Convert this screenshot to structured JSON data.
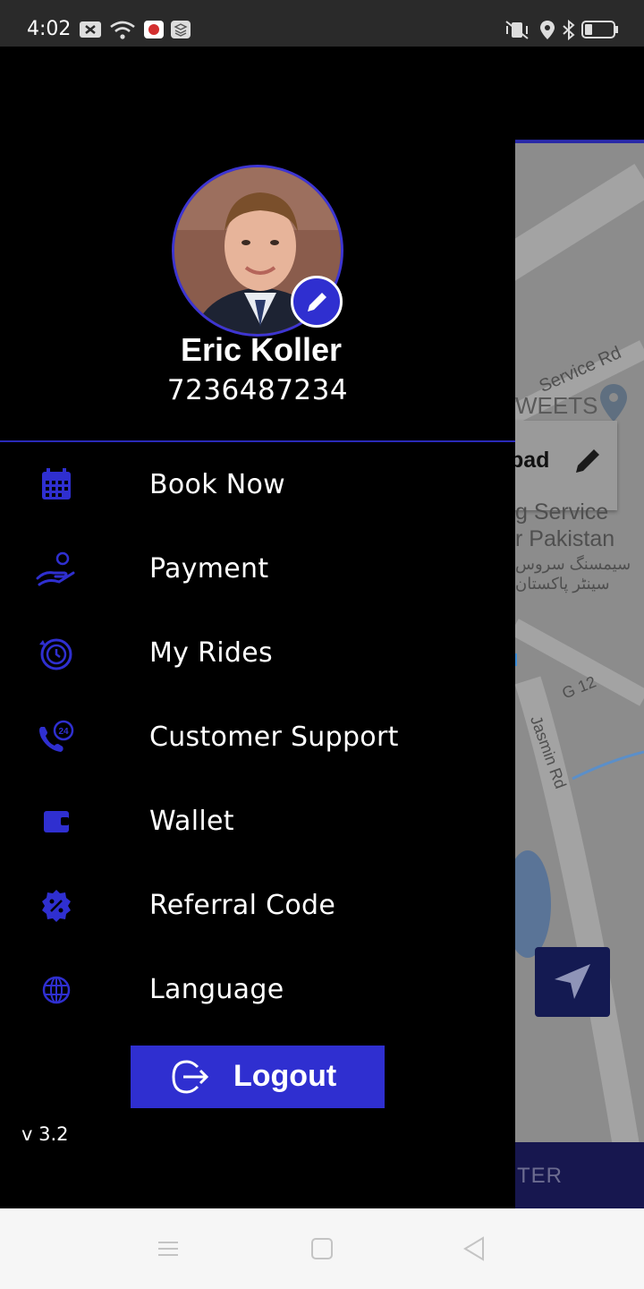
{
  "status_bar": {
    "time": "4:02",
    "icons": [
      "notification-x-icon",
      "wifi-icon",
      "app-notification-icon",
      "stack-icon",
      "vibrate-icon",
      "location-icon",
      "bluetooth-icon",
      "battery-icon"
    ]
  },
  "map": {
    "labels": {
      "service_rd": "Service Rd",
      "sweets": "WEETS",
      "card_text": "bad",
      "service": "g Service",
      "pakistan": "r Pakistan",
      "urdu1": "سیمسنگ سروس",
      "urdu2": "سینٹر پاکستان",
      "g12": "G 12",
      "jasmin": "Jasmin Rd"
    },
    "bottom_button": "TER"
  },
  "profile": {
    "name": "Eric Koller",
    "phone": "7236487234"
  },
  "menu": [
    {
      "label": "Book Now",
      "icon": "calendar-icon"
    },
    {
      "label": "Payment",
      "icon": "payment-hand-icon"
    },
    {
      "label": "My Rides",
      "icon": "history-icon"
    },
    {
      "label": "Customer Support",
      "icon": "support-24-icon"
    },
    {
      "label": "Wallet",
      "icon": "wallet-icon"
    },
    {
      "label": "Referral Code",
      "icon": "discount-badge-icon"
    },
    {
      "label": "Language",
      "icon": "globe-icon"
    }
  ],
  "logout": {
    "label": "Logout",
    "icon": "logout-icon"
  },
  "version": "v 3.2",
  "nav_bar": [
    "menu-icon",
    "home-icon",
    "back-icon"
  ],
  "colors": {
    "accent": "#2f2fd0",
    "drawer_bg": "#000000",
    "divider": "#2a2ab8"
  }
}
